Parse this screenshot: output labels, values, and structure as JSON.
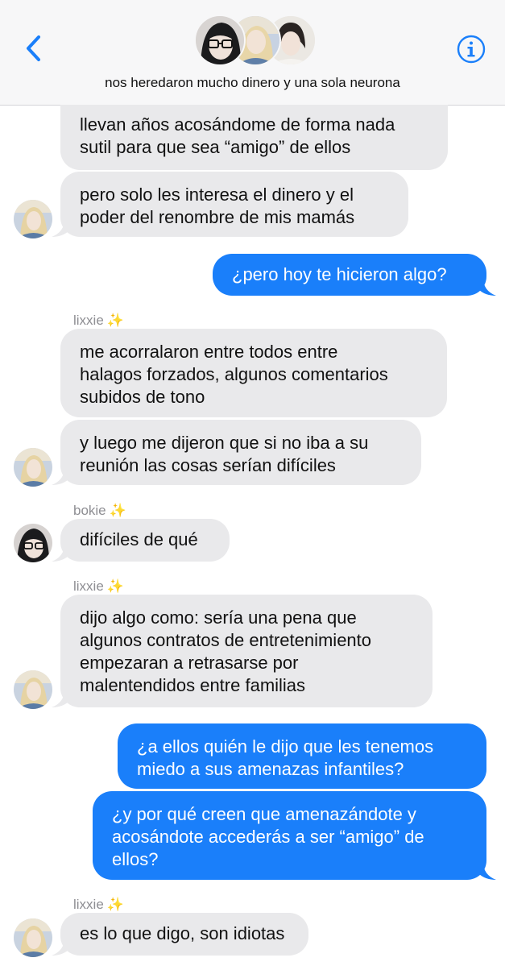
{
  "header": {
    "title": "nos heredaron mucho dinero y una sola neurona",
    "back_icon": "chevron-left-icon",
    "info_icon": "info-icon",
    "accent": "#1a7ffa"
  },
  "colors": {
    "sent_bubble": "#1a7ffa",
    "received_bubble": "#e9e9eb",
    "sender_name": "#8e8e93"
  },
  "messages": [
    {
      "direction": "in",
      "lines": [
        "llevan años acosándome de forma nada",
        "sutil para que sea “amigo” de ellos"
      ]
    },
    {
      "direction": "in",
      "lines": [
        "pero solo les interesa el dinero y el",
        "poder del renombre de mis mamás"
      ]
    },
    {
      "direction": "out",
      "lines": [
        "¿pero hoy te hicieron algo?"
      ]
    },
    {
      "direction": "in",
      "sender": "lixxie",
      "sender_emoji": "✨",
      "lines": [
        "me acorralaron entre todos entre",
        "halagos forzados, algunos comentarios",
        "subidos de tono"
      ]
    },
    {
      "direction": "in",
      "lines": [
        "y luego me dijeron que si no iba a su",
        "reunión las cosas serían difíciles"
      ]
    },
    {
      "direction": "in",
      "sender": "bokie",
      "sender_emoji": "✨",
      "lines": [
        "difíciles de qué"
      ]
    },
    {
      "direction": "in",
      "sender": "lixxie",
      "sender_emoji": "✨",
      "lines": [
        "dijo algo como: sería una pena que",
        "algunos contratos de entretenimiento",
        "empezaran a retrasarse por",
        "malentendidos entre familias"
      ]
    },
    {
      "direction": "out",
      "lines": [
        "¿a ellos quién le dijo que les tenemos",
        "miedo a sus amenazas infantiles?"
      ]
    },
    {
      "direction": "out",
      "lines": [
        "¿y por qué creen que amenazándote y",
        "acosándote accederás a ser “amigo” de",
        "ellos?"
      ]
    },
    {
      "direction": "in",
      "sender": "lixxie",
      "sender_emoji": "✨",
      "lines": [
        "es lo que digo, son idiotas"
      ]
    }
  ]
}
